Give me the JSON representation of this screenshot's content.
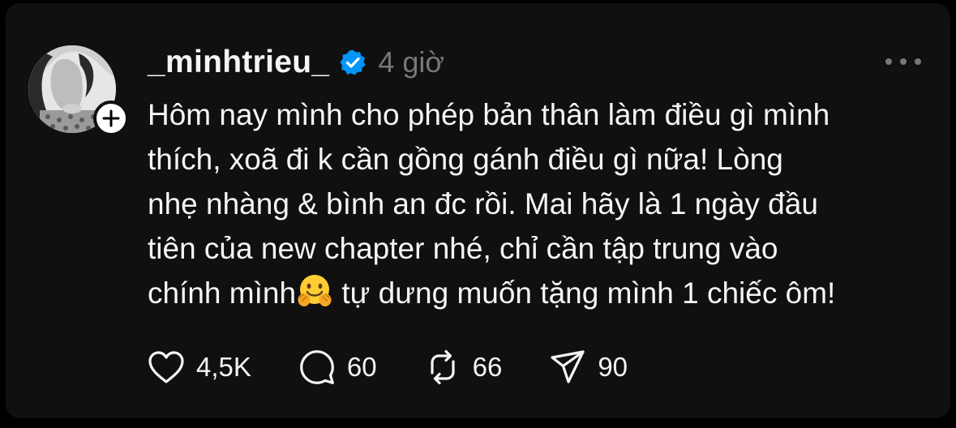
{
  "post": {
    "username": "_minhtrieu_",
    "verified": true,
    "time": "4 giờ",
    "text_lines": [
      "Hôm nay mình cho phép bản thân làm điều gì mình",
      "thích, xoã đi k cần gồng gánh điều gì nữa! Lòng",
      "nhẹ nhàng & bình an đc rồi. Mai hãy là 1 ngày đầu",
      "tiên của new chapter nhé, chỉ cần tập trung vào"
    ],
    "last_line_before_emoji": "chính mình",
    "emoji": "hugging-face",
    "last_line_after_emoji": " tự dưng muốn tặng mình 1 chiếc ôm!"
  },
  "actions": {
    "likes": "4,5K",
    "replies": "60",
    "reposts": "66",
    "shares": "90"
  },
  "colors": {
    "background": "#000000",
    "card": "#101010",
    "text": "#f3f5f7",
    "muted": "#777777",
    "verified_blue": "#0095f6"
  },
  "icons": [
    "plus-icon",
    "verified-badge-icon",
    "more-icon",
    "heart-icon",
    "comment-icon",
    "repost-icon",
    "share-icon"
  ]
}
